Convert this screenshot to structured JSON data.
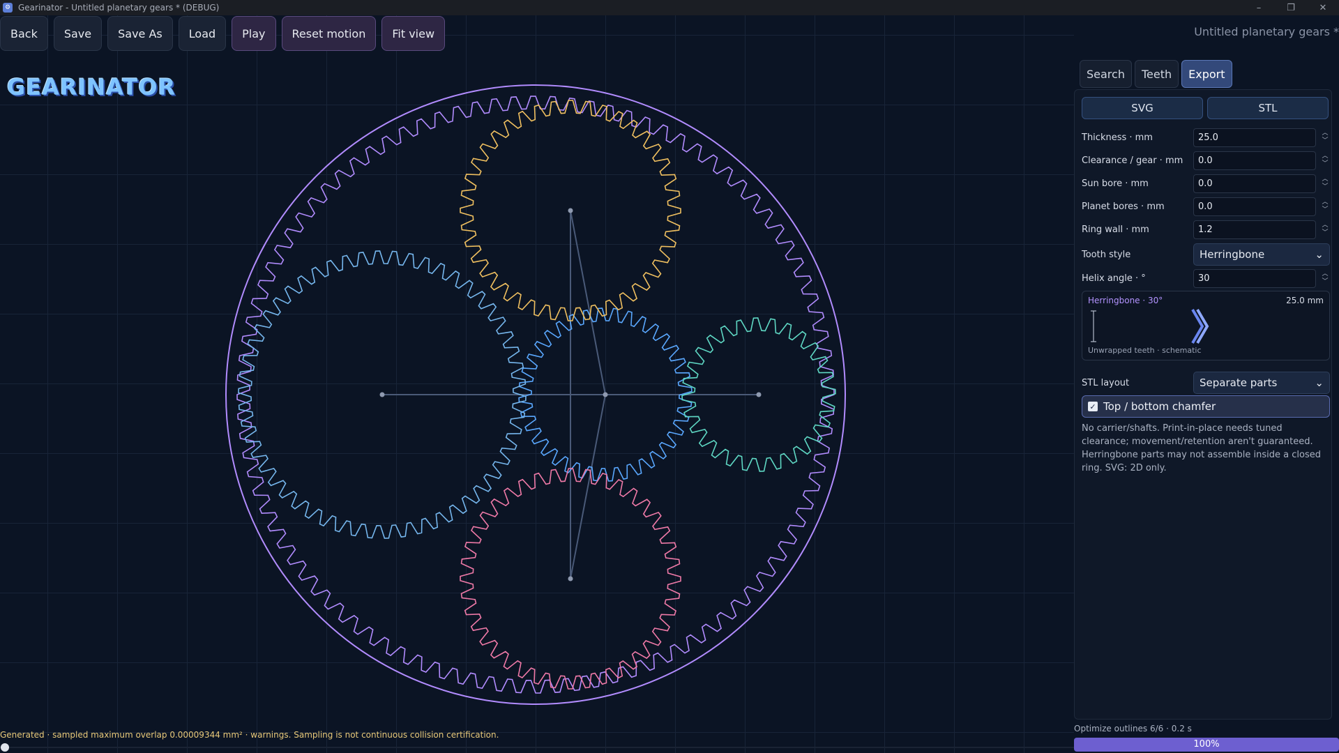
{
  "window": {
    "title": "Gearinator - Untitled planetary gears * (DEBUG)",
    "controls": [
      "–",
      "❐",
      "✕"
    ]
  },
  "toolbar": {
    "back": "Back",
    "save": "Save",
    "save_as": "Save As",
    "load": "Load",
    "play": "Play",
    "reset_motion": "Reset motion",
    "fit_view": "Fit view"
  },
  "document_title": "Untitled planetary gears *",
  "logo": "GEARINATOR",
  "status": "Generated · sampled maximum overlap 0.00009344 mm² · warnings. Sampling is not continuous collision certification.",
  "panel": {
    "tabs": [
      {
        "label": "Search",
        "active": false
      },
      {
        "label": "Teeth",
        "active": false
      },
      {
        "label": "Export",
        "active": true
      }
    ],
    "formats": {
      "svg": "SVG",
      "stl": "STL"
    },
    "fields": [
      {
        "label": "Thickness · mm",
        "value": "25.0"
      },
      {
        "label": "Clearance / gear · mm",
        "value": "0.0"
      },
      {
        "label": "Sun bore · mm",
        "value": "0.0"
      },
      {
        "label": "Planet bores · mm",
        "value": "0.0"
      },
      {
        "label": "Ring wall · mm",
        "value": "1.2"
      }
    ],
    "tooth_style": {
      "label": "Tooth style",
      "value": "Herringbone"
    },
    "helix_angle": {
      "label": "Helix angle · °",
      "value": "30"
    },
    "preview": {
      "title": "Herringbone · 30°",
      "size": "25.0 mm",
      "caption": "Unwrapped teeth · schematic"
    },
    "stl_layout": {
      "label": "STL layout",
      "value": "Separate parts"
    },
    "chamfer": {
      "label": "Top / bottom chamfer",
      "checked": true
    },
    "note": "No carrier/shafts. Print-in-place needs tuned clearance; movement/retention aren't guaranteed. Herringbone parts may not assemble inside a closed ring. SVG: 2D only."
  },
  "progress": {
    "label": "Optimize outlines 6/6 · 0.2 s",
    "percent_text": "100%",
    "fraction": 1.0
  },
  "colors": {
    "ring": "#b28cff",
    "sun": "#5aa8ff",
    "planet_top": "#f0c060",
    "planet_left": "#76b7ee",
    "planet_right": "#5fd8c4",
    "planet_bottom": "#f07aa8",
    "accent": "#6d5fd0"
  }
}
